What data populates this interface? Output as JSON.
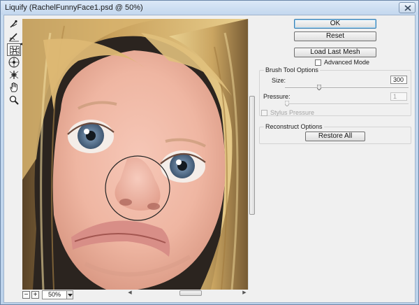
{
  "window": {
    "title": "Liquify (RachelFunnyFace1.psd @ 50%)"
  },
  "toolbox": {
    "tools": [
      {
        "name": "forward-warp-icon"
      },
      {
        "name": "reconstruct-icon"
      },
      {
        "name": "pucker-icon",
        "selected": true
      },
      {
        "name": "bloat-icon"
      },
      {
        "name": "push-left-icon"
      },
      {
        "name": "hand-icon"
      },
      {
        "name": "zoom-icon"
      }
    ]
  },
  "preview": {
    "zoom_value": "50%"
  },
  "buttons": {
    "ok": "OK",
    "reset": "Reset",
    "load_last_mesh": "Load Last Mesh",
    "restore_all": "Restore All"
  },
  "advanced_mode": {
    "label": "Advanced Mode",
    "checked": false
  },
  "brush_tool_options": {
    "title": "Brush Tool Options",
    "size_label": "Size:",
    "size_value": "300",
    "pressure_label": "Pressure:",
    "pressure_value": "1",
    "stylus_pressure_label": "Stylus Pressure"
  },
  "reconstruct_options": {
    "title": "Reconstruct Options"
  },
  "colors": {
    "window_frame": "#c9dcf1",
    "panel_bg": "#f0f0f0",
    "default_button_border": "#3c7fb1"
  }
}
